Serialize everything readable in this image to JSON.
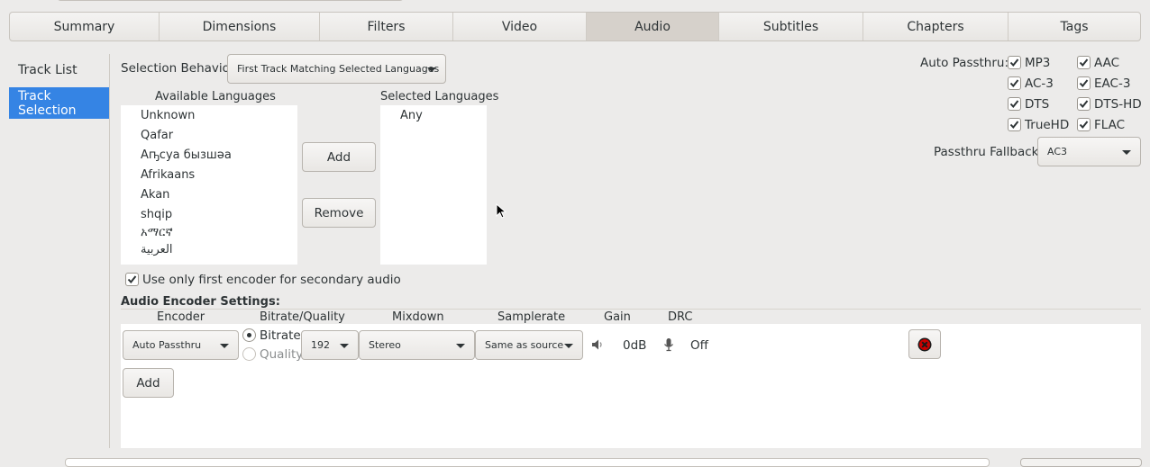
{
  "tabs": [
    "Summary",
    "Dimensions",
    "Filters",
    "Video",
    "Audio",
    "Subtitles",
    "Chapters",
    "Tags"
  ],
  "active_tab": "Audio",
  "sidebar": {
    "items": [
      {
        "label": "Track List"
      },
      {
        "label": "Track Selection"
      }
    ],
    "selected": "Track Selection"
  },
  "selection_behavior": {
    "label": "Selection Behavior:",
    "value": "First Track Matching Selected Languages"
  },
  "available_languages": {
    "header": "Available Languages",
    "items": [
      "Unknown",
      "Qafar",
      "Аҧсуа бызшәа",
      "Afrikaans",
      "Akan",
      "shqip",
      "አማርኛ",
      "العربية"
    ]
  },
  "selected_languages": {
    "header": "Selected Languages",
    "items": [
      "Any"
    ]
  },
  "buttons": {
    "add": "Add",
    "remove": "Remove",
    "add_encoder": "Add"
  },
  "auto_passthru": {
    "label": "Auto Passthru:",
    "options": [
      {
        "label": "MP3",
        "checked": true
      },
      {
        "label": "AAC",
        "checked": true
      },
      {
        "label": "AC-3",
        "checked": true
      },
      {
        "label": "EAC-3",
        "checked": true
      },
      {
        "label": "DTS",
        "checked": true
      },
      {
        "label": "DTS-HD",
        "checked": true
      },
      {
        "label": "TrueHD",
        "checked": true
      },
      {
        "label": "FLAC",
        "checked": true
      }
    ]
  },
  "passthru_fallback": {
    "label": "Passthru Fallback:",
    "value": "AC3"
  },
  "secondary_audio": {
    "label": "Use only first encoder for secondary audio",
    "checked": true
  },
  "encoder_settings": {
    "title": "Audio Encoder Settings:",
    "columns": [
      "Encoder",
      "Bitrate/Quality",
      "Mixdown",
      "Samplerate",
      "Gain",
      "DRC"
    ],
    "row": {
      "encoder": "Auto Passthru",
      "bitrate_label": "Bitrate",
      "quality_label": "Quality",
      "bitrate_selected": true,
      "bitrate": "192",
      "mixdown": "Stereo",
      "samplerate": "Same as source",
      "gain": "0dB",
      "drc": "Off"
    }
  },
  "icons": {
    "speaker": "speaker-icon",
    "mic": "microphone-icon",
    "remove": "close-circle-icon",
    "checkmark": "checkmark-icon"
  },
  "colors": {
    "selection": "#3584e4",
    "remove_icon": "#cc0000",
    "active_tab": "#d6d1cb"
  }
}
